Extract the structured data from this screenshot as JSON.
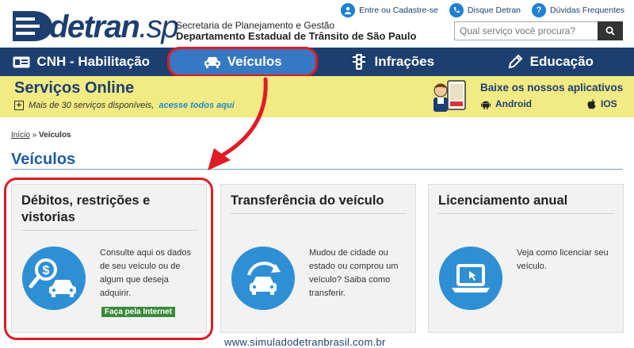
{
  "header": {
    "logo_text": "detran",
    "logo_suffix": ".sp",
    "secretaria": "Secretaria de Planejamento e Gestão",
    "departamento": "Departamento Estadual de Trânsito de São Paulo",
    "links": {
      "login": "Entre ou Cadastre-se",
      "disque": "Disque Detran",
      "faq": "Dúvidas Frequentes"
    },
    "search_placeholder": "Qual serviço você procura?"
  },
  "nav": {
    "items": [
      {
        "label": "CNH - Habilitação",
        "icon": "license-card-icon"
      },
      {
        "label": "Veículos",
        "icon": "car-icon"
      },
      {
        "label": "Infrações",
        "icon": "traffic-light-icon"
      },
      {
        "label": "Educação",
        "icon": "pencil-icon"
      }
    ],
    "active": "Veículos"
  },
  "band": {
    "title": "Serviços Online",
    "subtitle_prefix": "Mais de 30 serviços disponíveis,",
    "subtitle_link": "acesse todos aqui",
    "apps_title": "Baixe os nossos aplicativos",
    "android": "Android",
    "ios": "IOS"
  },
  "breadcrumb": {
    "home": "Início",
    "sep": "»",
    "current": "Veículos"
  },
  "page_title": "Veículos",
  "cards": [
    {
      "title": "Débitos, restrições e vistorias",
      "text": "Consulte aqui os dados de seu veículo ou de algum que deseja adquirir.",
      "cta": "Faça pela Internet",
      "icon": "search-car-money-icon"
    },
    {
      "title": "Transferência do veículo",
      "text": "Mudou de cidade ou estado ou comprou um veículo? Saiba como transferir.",
      "icon": "car-transfer-icon"
    },
    {
      "title": "Licenciamento anual",
      "text": "Veja como licenciar seu veículo.",
      "icon": "laptop-icon"
    }
  ],
  "watermark": "www.simuladodetranbrasil.com.br",
  "colors": {
    "navy": "#1d3f70",
    "active_tab": "#3778c3",
    "band": "#f2ea83",
    "highlight": "#e01b24",
    "icon_circle": "#2f8fd5",
    "cta": "#3b8a3c"
  }
}
